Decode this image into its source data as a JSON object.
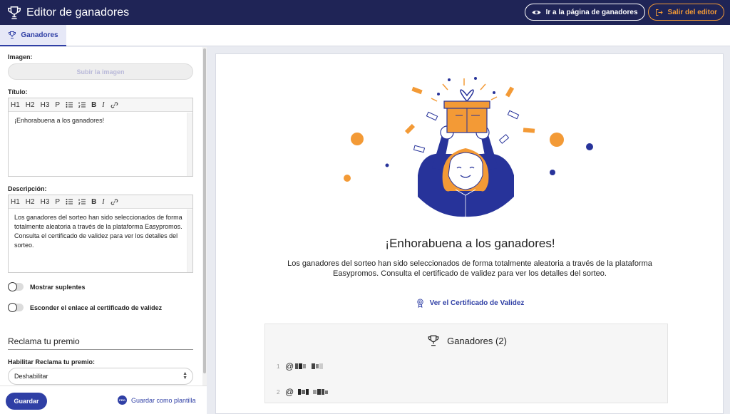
{
  "header": {
    "title": "Editor de ganadores",
    "go_to_winners_label": "Ir a la página de ganadores",
    "exit_label": "Salir del editor"
  },
  "tabs": [
    {
      "label": "Ganadores"
    }
  ],
  "form": {
    "image_label": "Imagen:",
    "upload_label": "Subir la imagen",
    "title_label": "Título:",
    "title_toolbar": [
      "H1",
      "H2",
      "H3",
      "P"
    ],
    "title_value": "¡Enhorabuena a los ganadores!",
    "description_label": "Descripción:",
    "description_value": "Los ganadores del sorteo han sido seleccionados de forma totalmente aleatoria a través de la plataforma Easypromos. Consulta el certificado de validez para ver los detalles del sorteo.",
    "toggle_substitutes": "Mostrar suplentes",
    "toggle_hide_cert": "Esconder el enlace al certificado de validez",
    "claim_section": "Reclama tu premio",
    "claim_enable_label": "Habilitar Reclama tu premio:",
    "claim_select_value": "Deshabilitar"
  },
  "footer": {
    "save_label": "Guardar",
    "pro_badge": "PRO",
    "save_template_label": "Guardar como plantilla"
  },
  "preview": {
    "title": "¡Enhorabuena a los ganadores!",
    "description": "Los ganadores del sorteo han sido seleccionados de forma totalmente aleatoria a través de la plataforma Easypromos. Consulta el certificado de validez para ver los detalles del sorteo.",
    "certificate_link": "Ver el Certificado de Validez",
    "winners_heading": "Ganadores (2)",
    "winners": [
      {
        "index": "1",
        "handle": "@"
      },
      {
        "index": "2",
        "handle": "@"
      }
    ]
  },
  "colors": {
    "header_bg": "#1f2456",
    "accent": "#2f3fa5",
    "orange": "#f39a36"
  },
  "icons": [
    "trophy-icon",
    "eye-icon",
    "exit-icon",
    "bullet-list-icon",
    "numbered-list-icon",
    "link-icon",
    "medal-icon"
  ]
}
